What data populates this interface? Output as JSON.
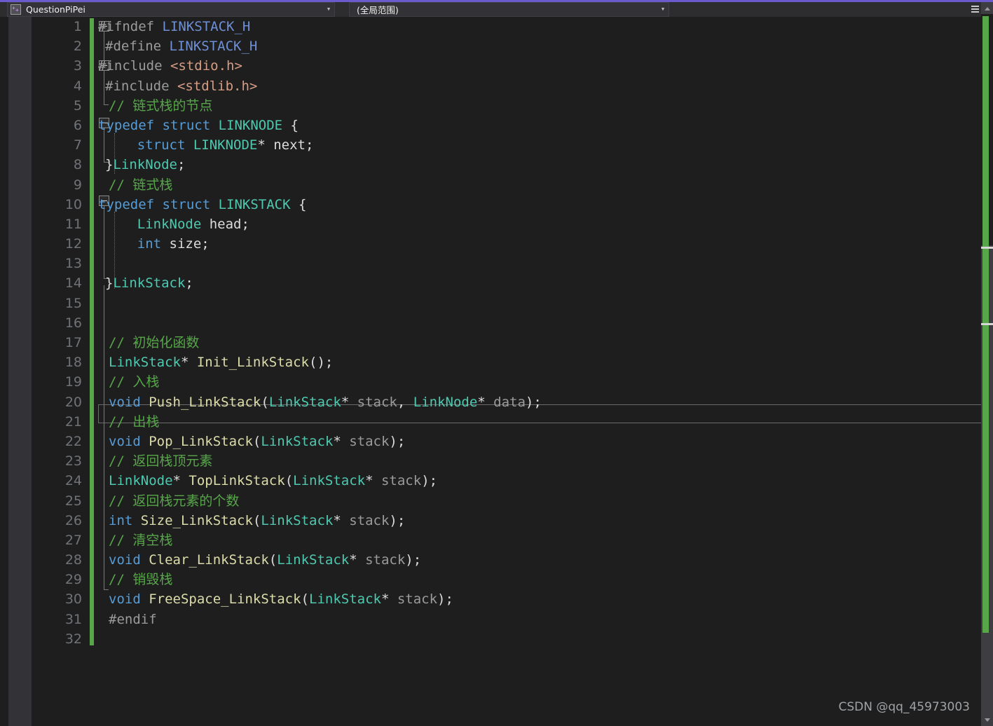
{
  "window": {
    "accent_color": "#6a5acd",
    "background": "#1e1e1e"
  },
  "navbar": {
    "project_combo": {
      "icon": "cpp-file-icon",
      "value": "QuestionPiPei",
      "arrow": "▼"
    },
    "scope_combo": {
      "value": "(全局范围)",
      "arrow": "▼"
    },
    "tail_arrow": "▼"
  },
  "editor": {
    "language": "c",
    "current_line": 21,
    "total_lines": 32,
    "change_bar_color": "#57a64a",
    "line_numbers": [
      1,
      2,
      3,
      4,
      5,
      6,
      7,
      8,
      9,
      10,
      11,
      12,
      13,
      14,
      15,
      16,
      17,
      18,
      19,
      20,
      21,
      22,
      23,
      24,
      25,
      26,
      27,
      28,
      29,
      30,
      31,
      32
    ],
    "lines": [
      {
        "n": 1,
        "text": "#ifndef LINKSTACK_H"
      },
      {
        "n": 2,
        "text": " #define LINKSTACK_H"
      },
      {
        "n": 3,
        "text": "#include <stdio.h>"
      },
      {
        "n": 4,
        "text": " #include <stdlib.h>"
      },
      {
        "n": 5,
        "text": " // 链式栈的节点"
      },
      {
        "n": 6,
        "text": "typedef struct LINKNODE {"
      },
      {
        "n": 7,
        "text": "     struct LINKNODE* next;"
      },
      {
        "n": 8,
        "text": " }LinkNode;"
      },
      {
        "n": 9,
        "text": " // 链式栈"
      },
      {
        "n": 10,
        "text": "typedef struct LINKSTACK {"
      },
      {
        "n": 11,
        "text": "     LinkNode head;"
      },
      {
        "n": 12,
        "text": "     int size;"
      },
      {
        "n": 13,
        "text": ""
      },
      {
        "n": 14,
        "text": " }LinkStack;"
      },
      {
        "n": 15,
        "text": ""
      },
      {
        "n": 16,
        "text": ""
      },
      {
        "n": 17,
        "text": " // 初始化函数"
      },
      {
        "n": 18,
        "text": " LinkStack* Init_LinkStack();"
      },
      {
        "n": 19,
        "text": " // 入栈"
      },
      {
        "n": 20,
        "text": " void Push_LinkStack(LinkStack* stack, LinkNode* data);"
      },
      {
        "n": 21,
        "text": " // 出栈"
      },
      {
        "n": 22,
        "text": " void Pop_LinkStack(LinkStack* stack);"
      },
      {
        "n": 23,
        "text": " // 返回栈顶元素"
      },
      {
        "n": 24,
        "text": " LinkNode* TopLinkStack(LinkStack* stack);"
      },
      {
        "n": 25,
        "text": " // 返回栈元素的个数"
      },
      {
        "n": 26,
        "text": " int Size_LinkStack(LinkStack* stack);"
      },
      {
        "n": 27,
        "text": " // 清空栈"
      },
      {
        "n": 28,
        "text": " void Clear_LinkStack(LinkStack* stack);"
      },
      {
        "n": 29,
        "text": " // 销毁栈"
      },
      {
        "n": 30,
        "text": " void FreeSpace_LinkStack(LinkStack* stack);"
      },
      {
        "n": 31,
        "text": " #endif"
      },
      {
        "n": 32,
        "text": ""
      }
    ],
    "tokens": {
      "l1": [
        {
          "t": "#ifndef ",
          "c": "t-pre"
        },
        {
          "t": "LINKSTACK_H",
          "c": "t-macro"
        }
      ],
      "l2": [
        {
          "t": "#define ",
          "c": "t-pre"
        },
        {
          "t": "LINKSTACK_H",
          "c": "t-macro"
        }
      ],
      "l3": [
        {
          "t": "#include ",
          "c": "t-pre"
        },
        {
          "t": "<stdio.h>",
          "c": "t-inc"
        }
      ],
      "l4": [
        {
          "t": "#include ",
          "c": "t-pre"
        },
        {
          "t": "<stdlib.h>",
          "c": "t-inc"
        }
      ],
      "l5": [
        {
          "t": "// 链式栈的节点",
          "c": "t-cmt"
        }
      ],
      "l6": [
        {
          "t": "typedef ",
          "c": "t-kw"
        },
        {
          "t": "struct ",
          "c": "t-kw"
        },
        {
          "t": "LINKNODE",
          "c": "t-type"
        },
        {
          "t": " {",
          "c": "t-punct"
        }
      ],
      "l7": [
        {
          "t": "    ",
          "c": "t-punct"
        },
        {
          "t": "struct ",
          "c": "t-kw"
        },
        {
          "t": "LINKNODE",
          "c": "t-type"
        },
        {
          "t": "* next;",
          "c": "t-punct"
        }
      ],
      "l8": [
        {
          "t": "}",
          "c": "t-punct"
        },
        {
          "t": "LinkNode",
          "c": "t-type"
        },
        {
          "t": ";",
          "c": "t-punct"
        }
      ],
      "l9": [
        {
          "t": "// 链式栈",
          "c": "t-cmt"
        }
      ],
      "l10": [
        {
          "t": "typedef ",
          "c": "t-kw"
        },
        {
          "t": "struct ",
          "c": "t-kw"
        },
        {
          "t": "LINKSTACK",
          "c": "t-type"
        },
        {
          "t": " {",
          "c": "t-punct"
        }
      ],
      "l11": [
        {
          "t": "    ",
          "c": "t-punct"
        },
        {
          "t": "LinkNode",
          "c": "t-type"
        },
        {
          "t": " head;",
          "c": "t-punct"
        }
      ],
      "l12": [
        {
          "t": "    ",
          "c": "t-punct"
        },
        {
          "t": "int",
          "c": "t-kw"
        },
        {
          "t": " size;",
          "c": "t-punct"
        }
      ],
      "l14": [
        {
          "t": "}",
          "c": "t-punct"
        },
        {
          "t": "LinkStack",
          "c": "t-type"
        },
        {
          "t": ";",
          "c": "t-punct"
        }
      ],
      "l17": [
        {
          "t": "// 初始化函数",
          "c": "t-cmt"
        }
      ],
      "l18": [
        {
          "t": "LinkStack",
          "c": "t-type"
        },
        {
          "t": "* ",
          "c": "t-punct"
        },
        {
          "t": "Init_LinkStack",
          "c": "t-fn"
        },
        {
          "t": "();",
          "c": "t-punct"
        }
      ],
      "l19": [
        {
          "t": "// 入栈",
          "c": "t-cmt"
        }
      ],
      "l20": [
        {
          "t": "void ",
          "c": "t-kw"
        },
        {
          "t": "Push_LinkStack",
          "c": "t-fn"
        },
        {
          "t": "(",
          "c": "t-punct"
        },
        {
          "t": "LinkStack",
          "c": "t-type"
        },
        {
          "t": "* ",
          "c": "t-punct"
        },
        {
          "t": "stack",
          "c": "t-var"
        },
        {
          "t": ", ",
          "c": "t-punct"
        },
        {
          "t": "LinkNode",
          "c": "t-type"
        },
        {
          "t": "* ",
          "c": "t-punct"
        },
        {
          "t": "data",
          "c": "t-var"
        },
        {
          "t": ");",
          "c": "t-punct"
        }
      ],
      "l21": [
        {
          "t": "// 出栈",
          "c": "t-cmt"
        }
      ],
      "l22": [
        {
          "t": "void ",
          "c": "t-kw"
        },
        {
          "t": "Pop_LinkStack",
          "c": "t-fn"
        },
        {
          "t": "(",
          "c": "t-punct"
        },
        {
          "t": "LinkStack",
          "c": "t-type"
        },
        {
          "t": "* ",
          "c": "t-punct"
        },
        {
          "t": "stack",
          "c": "t-var"
        },
        {
          "t": ");",
          "c": "t-punct"
        }
      ],
      "l23": [
        {
          "t": "// 返回栈顶元素",
          "c": "t-cmt"
        }
      ],
      "l24": [
        {
          "t": "LinkNode",
          "c": "t-type"
        },
        {
          "t": "* ",
          "c": "t-punct"
        },
        {
          "t": "TopLinkStack",
          "c": "t-fn"
        },
        {
          "t": "(",
          "c": "t-punct"
        },
        {
          "t": "LinkStack",
          "c": "t-type"
        },
        {
          "t": "* ",
          "c": "t-punct"
        },
        {
          "t": "stack",
          "c": "t-var"
        },
        {
          "t": ");",
          "c": "t-punct"
        }
      ],
      "l25": [
        {
          "t": "// 返回栈元素的个数",
          "c": "t-cmt"
        }
      ],
      "l26": [
        {
          "t": "int ",
          "c": "t-kw"
        },
        {
          "t": "Size_LinkStack",
          "c": "t-fn"
        },
        {
          "t": "(",
          "c": "t-punct"
        },
        {
          "t": "LinkStack",
          "c": "t-type"
        },
        {
          "t": "* ",
          "c": "t-punct"
        },
        {
          "t": "stack",
          "c": "t-var"
        },
        {
          "t": ");",
          "c": "t-punct"
        }
      ],
      "l27": [
        {
          "t": "// 清空栈",
          "c": "t-cmt"
        }
      ],
      "l28": [
        {
          "t": "void ",
          "c": "t-kw"
        },
        {
          "t": "Clear_LinkStack",
          "c": "t-fn"
        },
        {
          "t": "(",
          "c": "t-punct"
        },
        {
          "t": "LinkStack",
          "c": "t-type"
        },
        {
          "t": "* ",
          "c": "t-punct"
        },
        {
          "t": "stack",
          "c": "t-var"
        },
        {
          "t": ");",
          "c": "t-punct"
        }
      ],
      "l29": [
        {
          "t": "// 销毁栈",
          "c": "t-cmt"
        }
      ],
      "l30": [
        {
          "t": "void ",
          "c": "t-kw"
        },
        {
          "t": "FreeSpace_LinkStack",
          "c": "t-fn"
        },
        {
          "t": "(",
          "c": "t-punct"
        },
        {
          "t": "LinkStack",
          "c": "t-type"
        },
        {
          "t": "* ",
          "c": "t-punct"
        },
        {
          "t": "stack",
          "c": "t-var"
        },
        {
          "t": ");",
          "c": "t-punct"
        }
      ],
      "l31": [
        {
          "t": "#endif",
          "c": "t-pre"
        }
      ]
    }
  },
  "scrollbar": {
    "up_arrow": "▲",
    "down_arrow": "▼",
    "track_color": "#57a64a"
  },
  "watermark": {
    "text": "CSDN @qq_45973003"
  }
}
